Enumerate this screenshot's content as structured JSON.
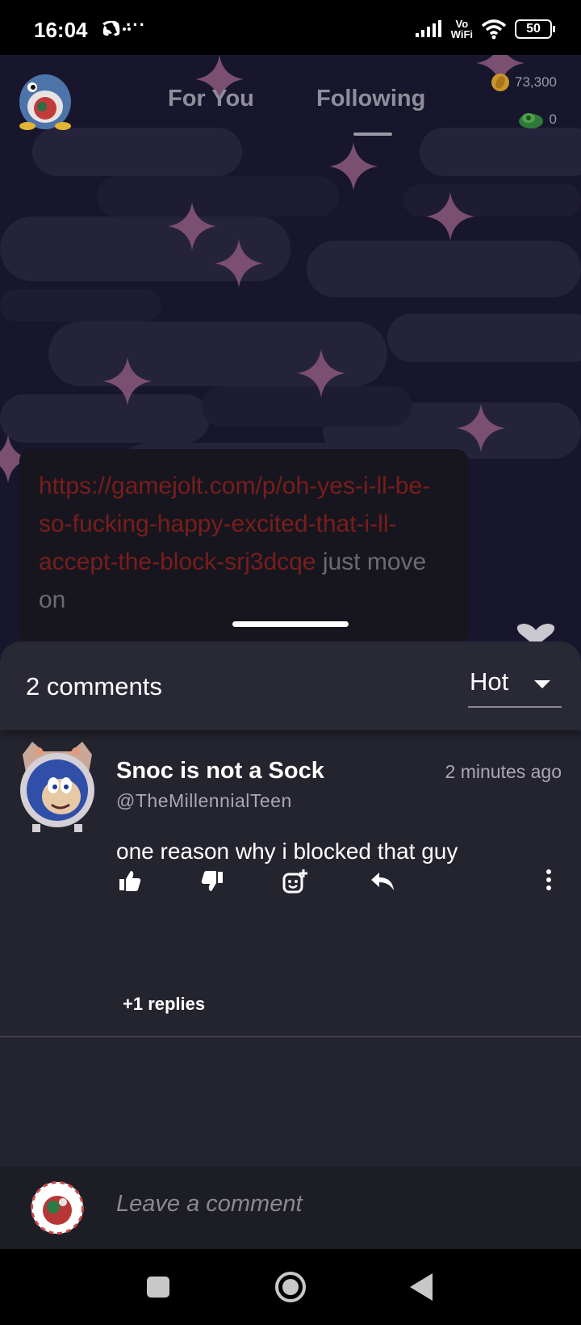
{
  "status_bar": {
    "time": "16:04",
    "overflow": "···",
    "volte_top": "Vo",
    "volte_bottom": "WiFi",
    "battery": "50",
    "icons": [
      "discord-icon",
      "signal-icon",
      "wifi-icon",
      "battery-icon"
    ]
  },
  "top_nav": {
    "tabs": [
      {
        "label": "For You",
        "active": false
      },
      {
        "label": "Following",
        "active": true
      }
    ],
    "coins": "73,300",
    "cash": "0"
  },
  "post": {
    "link_text": "https://gamejolt.com/p/oh-yes-i-ll-be-so-fucking-happy-excited-that-i-ll-accept-the-block-srj3dcqe",
    "text_after": " just move on"
  },
  "comments": {
    "count_label": "2 comments",
    "sort_value": "Hot",
    "items": [
      {
        "display_name": "Snoc is not a Sock",
        "handle": "@TheMillennialTeen",
        "time": "2 minutes ago",
        "body": "one reason why i blocked that guy",
        "replies_label": "+1 replies"
      }
    ]
  },
  "compose": {
    "placeholder": "Leave a comment"
  },
  "colors": {
    "sheet_bg": "#24242f",
    "link_dark_red": "#7a1d1d",
    "scene_bg": "#15142a"
  }
}
